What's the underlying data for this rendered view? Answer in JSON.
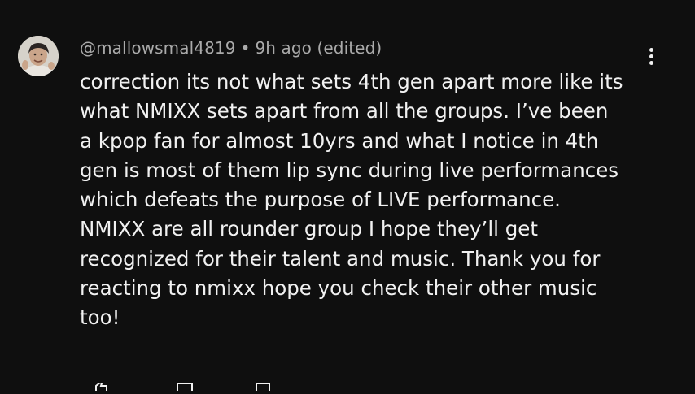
{
  "comment": {
    "author": "@mallowsmal4819",
    "separator": "•",
    "time": "9h ago (edited)",
    "text_lines": [
      "correction its not what sets 4th gen apart more like its",
      "what NMIXX sets apart from all the groups. I’ve been",
      "a kpop fan for almost 10yrs and what I notice in 4th",
      "gen is most of them lip sync during live performances",
      "which defeats the purpose of LIVE performance.",
      "NMIXX are all rounder group I hope they’ll get",
      "recognized for their talent and music. Thank you for",
      "reacting to nmixx hope you check their other music",
      "too!"
    ]
  },
  "icons": {
    "avatar": "avatar-photo",
    "more": "more-vertical-icon",
    "like": "thumbs-up-icon",
    "dislike": "thumbs-down-icon",
    "reply": "reply-icon"
  },
  "colors": {
    "background": "#0f0f0f",
    "text": "#f1f1f1",
    "meta": "#aaaaaa"
  }
}
